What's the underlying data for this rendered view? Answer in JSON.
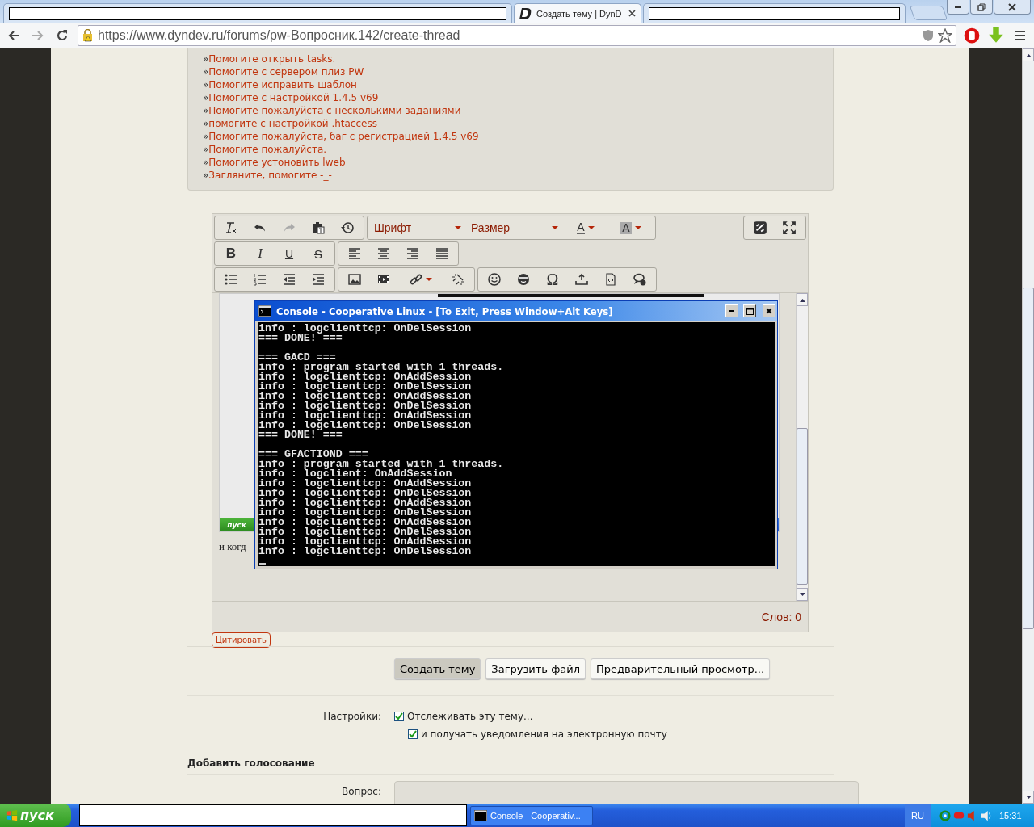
{
  "browser": {
    "tabs": [
      {
        "selected": false
      },
      {
        "title": "Создать тему | DynD",
        "selected": true
      },
      {
        "selected": false
      }
    ],
    "address": "https://www.dyndev.ru/forums/pw-Вопросник.142/create-thread"
  },
  "related_threads": [
    {
      "marker": "»",
      "title": "Помогите открыть tasks."
    },
    {
      "marker": "»",
      "title": "Помогите с сервером плиз PW"
    },
    {
      "marker": "»",
      "title": "Помогите исправить шаблон"
    },
    {
      "marker": "»",
      "title": "Помогите с настройкой 1.4.5 v69"
    },
    {
      "marker": "»",
      "title": "Помогите пожалуйста с несколькими заданиями"
    },
    {
      "marker": "»",
      "title": "помогите с настройкой .htaccess"
    },
    {
      "marker": "»",
      "title": "Помогите пожалуйста, баг с регистрацией 1.4.5 v69"
    },
    {
      "marker": "»",
      "title": "Помогите пожалуйста."
    },
    {
      "marker": "»",
      "title": "Помогите устоновить lweb"
    },
    {
      "marker": "»",
      "title": "Загляните, помогите -_-"
    }
  ],
  "editor": {
    "font": "Шрифт",
    "size": "Размер",
    "text_color": "A",
    "background_color": "A",
    "format_buttons": [
      "B",
      "I",
      "U",
      "S"
    ],
    "special_char": "Ω",
    "content": {
      "start_button": "пуск",
      "caption": "и когд",
      "console": {
        "title": "Console - Cooperative Linux - [To Exit, Press Window+Alt Keys]",
        "blocks": [
          [
            "info : logclienttcp: OnDelSession",
            "=== DONE! ==="
          ],
          [
            "=== GACD ===",
            "info : program started with 1 threads.",
            "info : logclienttcp: OnAddSession",
            "info : logclienttcp: OnDelSession",
            "info : logclienttcp: OnAddSession",
            "info : logclienttcp: OnDelSession",
            "info : logclienttcp: OnAddSession",
            "info : logclienttcp: OnDelSession",
            "=== DONE! ==="
          ],
          [
            "=== GFACTIOND ===",
            "info : program started with 1 threads.",
            "info : logclient: OnAddSession",
            "info : logclienttcp: OnAddSession",
            "info : logclienttcp: OnDelSession",
            "info : logclienttcp: OnAddSession",
            "info : logclienttcp: OnDelSession",
            "info : logclienttcp: OnAddSession",
            "info : logclienttcp: OnDelSession",
            "info : logclienttcp: OnAddSession",
            "info : logclienttcp: OnDelSession"
          ]
        ]
      }
    },
    "word_count": "Слов: 0"
  },
  "quote_button": "Цитировать",
  "buttons": [
    {
      "label": "Создать тему",
      "primary": true
    },
    {
      "label": "Загрузить файл",
      "primary": false
    },
    {
      "label": "Предварительный просмотр...",
      "primary": false
    }
  ],
  "settings": {
    "label": "Настройки:",
    "options": [
      {
        "label": "Отслеживать эту тему...",
        "checked": true,
        "children": [
          {
            "label": "и получать уведомления на электронную почту",
            "checked": true
          }
        ]
      }
    ]
  },
  "poll": {
    "heading": "Добавить голосование",
    "question_label": "Вопрос:"
  },
  "taskbar": {
    "start": "пуск",
    "tasks": [
      {
        "label": "Console - Cooperativ...",
        "selected": false
      }
    ],
    "language": "RU",
    "clock": "15:31"
  }
}
